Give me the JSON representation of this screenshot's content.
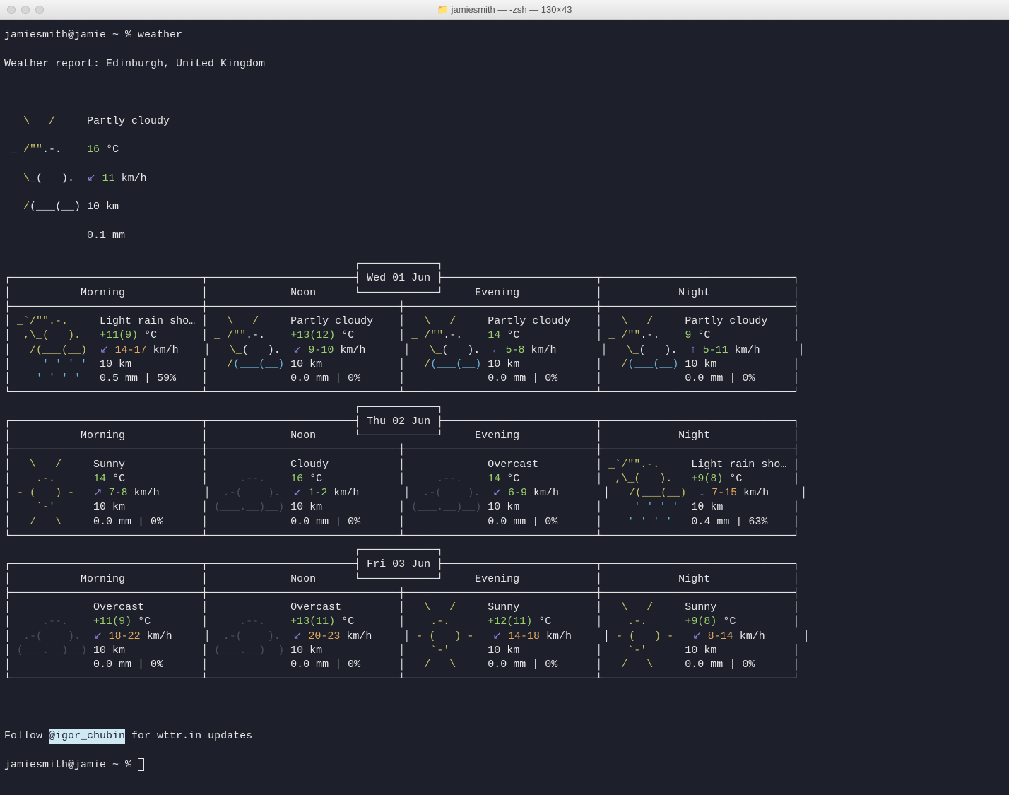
{
  "window": {
    "title": "jamiesmith — -zsh — 130×43"
  },
  "prompt": {
    "line1_pre": "jamiesmith@jamie ~ % ",
    "cmd": "weather",
    "report_line": "Weather report: Edinburgh, United Kingdom",
    "follow_pre": "Follow ",
    "follow_handle": "@igor_chubin",
    "follow_post": " for wttr.in updates",
    "line_end": "jamiesmith@jamie ~ % "
  },
  "current": {
    "art1a": "   \\   /",
    "art1b": "     Partly cloudy",
    "art2a": " _ /\"\"",
    "art2b": ".-.",
    "temp_pre": "    ",
    "temp": "16",
    "temp_unit": " °C",
    "art3a": "   \\_",
    "art3b": "(   ).",
    "wind_pre": "  ",
    "wind_arrow": "↙",
    "wind_val": " 11",
    "wind_unit": " km/h",
    "art4a": "   /",
    "art4b": "(___(__)",
    "vis": " 10 km",
    "art5_pad": "             ",
    "precip": "0.1 mm"
  },
  "days": [
    {
      "date_label": "Wed 01 Jun",
      "header": {
        "morning": "Morning",
        "noon": "Noon",
        "evening": "Evening",
        "night": "Night"
      },
      "cells": [
        {
          "art1": " _`/\"\".-.    ",
          "cond": " Light rain sho…",
          "art2": "  ,\\_(   ). ",
          "temp_pre": "  ",
          "temp_main": "+11",
          "temp_par": "(9)",
          "temp_unit": " °C",
          "art3": "   /(___(__)",
          "wind_pre": "  ",
          "wind_arrow": "↙",
          "wind_rng": " 14-17",
          "wind_unit": " km/h",
          "art4a": "     ",
          "art4b": "' ' ' '",
          "vis": "  10 km",
          "art5a": "    ",
          "art5b": "' ' ' '",
          "precip": "   0.5 mm | 59%"
        },
        {
          "art1a": "   \\   /",
          "art1b": "    ",
          "cond": " Partly cloudy",
          "art2a": " _ /\"\"",
          "art2b": ".-.",
          "temp_pre": "    ",
          "temp_main": "+13",
          "temp_par": "(12)",
          "temp_unit": " °C",
          "art3a": "   \\_",
          "art3b": "(   ).",
          "wind_pre": "  ",
          "wind_arrow": "↙",
          "wind_rng": " 9-10",
          "wind_unit": " km/h",
          "art4a": "   /",
          "art4b": "(___(__)",
          "vis": " 10 km",
          "art5_pad": "             ",
          "precip": "0.0 mm | 0%"
        },
        {
          "art1a": "   \\   /",
          "art1b": "    ",
          "cond": " Partly cloudy",
          "art2a": " _ /\"\"",
          "art2b": ".-.",
          "temp_pre": "    ",
          "temp_main": "14",
          "temp_par": "",
          "temp_unit": " °C",
          "art3a": "   \\_",
          "art3b": "(   ).",
          "wind_pre": "  ",
          "wind_arrow": "←",
          "wind_rng": " 5-8",
          "wind_unit": " km/h",
          "art4a": "   /",
          "art4b": "(___(__)",
          "vis": " 10 km",
          "art5_pad": "             ",
          "precip": "0.0 mm | 0%"
        },
        {
          "art1a": "   \\   /",
          "art1b": "    ",
          "cond": " Partly cloudy",
          "art2a": " _ /\"\"",
          "art2b": ".-.",
          "temp_pre": "    ",
          "temp_main": "9",
          "temp_par": "",
          "temp_unit": " °C",
          "art3a": "   \\_",
          "art3b": "(   ).",
          "wind_pre": "  ",
          "wind_arrow": "↑",
          "wind_rng": " 5-11",
          "wind_unit": " km/h",
          "art4a": "   /",
          "art4b": "(___(__)",
          "vis": " 10 km",
          "art5_pad": "             ",
          "precip": "0.0 mm | 0%"
        }
      ]
    },
    {
      "date_label": "Thu 02 Jun",
      "header": {
        "morning": "Morning",
        "noon": "Noon",
        "evening": "Evening",
        "night": "Night"
      },
      "cells": [
        {
          "art1a": "   \\   /",
          "cond": "     Sunny",
          "art2a": "    .-.",
          "temp_pre": "      ",
          "temp_main": "14",
          "temp_par": "",
          "temp_unit": " °C",
          "art3a": " - (   ) -",
          "wind_pre": "   ",
          "wind_arrow": "↗",
          "wind_rng": " 7-8",
          "wind_unit": " km/h",
          "art4a": "    `-'",
          "vis": "      10 km",
          "art5a": "   /   \\",
          "precip": "     0.0 mm | 0%"
        },
        {
          "art1_pad": "             ",
          "cond": "Cloudy",
          "art2a": "     .--.",
          "temp_pre": "    ",
          "temp_main": "16",
          "temp_par": "",
          "temp_unit": " °C",
          "art3a": "  .-(    ).",
          "wind_pre": "  ",
          "wind_arrow": "↙",
          "wind_rng": " 1-2",
          "wind_unit": " km/h",
          "art4a": " (___.__)__)",
          "vis": " 10 km",
          "art5_pad": "             ",
          "precip": "0.0 mm | 0%"
        },
        {
          "art1_pad": "             ",
          "cond": "Overcast",
          "art2a": "     .--.",
          "temp_pre": "    ",
          "temp_main": "14",
          "temp_par": "",
          "temp_unit": " °C",
          "art3a": "  .-(    ).",
          "wind_pre": "  ",
          "wind_arrow": "↙",
          "wind_rng": " 6-9",
          "wind_unit": " km/h",
          "art4a": " (___.__)__)",
          "vis": " 10 km",
          "art5_pad": "             ",
          "precip": "0.0 mm | 0%"
        },
        {
          "art1": " _`/\"\".-.    ",
          "cond": " Light rain sho…",
          "art2": "  ,\\_(   ). ",
          "temp_pre": "  ",
          "temp_main": "+9",
          "temp_par": "(8)",
          "temp_unit": " °C",
          "art3": "   /(___(__)",
          "wind_pre": "  ",
          "wind_arrow": "↓",
          "wind_rng": " 7-15",
          "wind_unit": " km/h",
          "art4a": "     ",
          "art4b": "' ' ' '",
          "vis": "  10 km",
          "art5a": "    ",
          "art5b": "' ' ' '",
          "precip": "   0.4 mm | 63%"
        }
      ]
    },
    {
      "date_label": "Fri 03 Jun",
      "header": {
        "morning": "Morning",
        "noon": "Noon",
        "evening": "Evening",
        "night": "Night"
      },
      "cells": [
        {
          "art1_pad": "             ",
          "cond": "Overcast",
          "art2a": "     .--.",
          "temp_pre": "    ",
          "temp_main": "+11",
          "temp_par": "(9)",
          "temp_unit": " °C",
          "art3a": "  .-(    ).",
          "wind_pre": "  ",
          "wind_arrow": "↙",
          "wind_rng": " 18-22",
          "wind_unit": " km/h",
          "art4a": " (___.__)__)",
          "vis": " 10 km",
          "art5_pad": "             ",
          "precip": "0.0 mm | 0%"
        },
        {
          "art1_pad": "             ",
          "cond": "Overcast",
          "art2a": "     .--.",
          "temp_pre": "    ",
          "temp_main": "+13",
          "temp_par": "(11)",
          "temp_unit": " °C",
          "art3a": "  .-(    ).",
          "wind_pre": "  ",
          "wind_arrow": "↙",
          "wind_rng": " 20-23",
          "wind_unit": " km/h",
          "art4a": " (___.__)__)",
          "vis": " 10 km",
          "art5_pad": "             ",
          "precip": "0.0 mm | 0%"
        },
        {
          "art1a": "   \\   /",
          "cond": "     Sunny",
          "art2a": "    .-.",
          "temp_pre": "      ",
          "temp_main": "+12",
          "temp_par": "(11)",
          "temp_unit": " °C",
          "art3a": " - (   ) -",
          "wind_pre": "   ",
          "wind_arrow": "↙",
          "wind_rng": " 14-18",
          "wind_unit": " km/h",
          "art4a": "    `-'",
          "vis": "      10 km",
          "art5a": "   /   \\",
          "precip": "     0.0 mm | 0%"
        },
        {
          "art1a": "   \\   /",
          "cond": "     Sunny",
          "art2a": "    .-.",
          "temp_pre": "      ",
          "temp_main": "+9",
          "temp_par": "(8)",
          "temp_unit": " °C",
          "art3a": " - (   ) -",
          "wind_pre": "   ",
          "wind_arrow": "↙",
          "wind_rng": " 8-14",
          "wind_unit": " km/h",
          "art4a": "    `-'",
          "vis": "      10 km",
          "art5a": "   /   \\",
          "precip": "     0.0 mm | 0%"
        }
      ]
    }
  ]
}
